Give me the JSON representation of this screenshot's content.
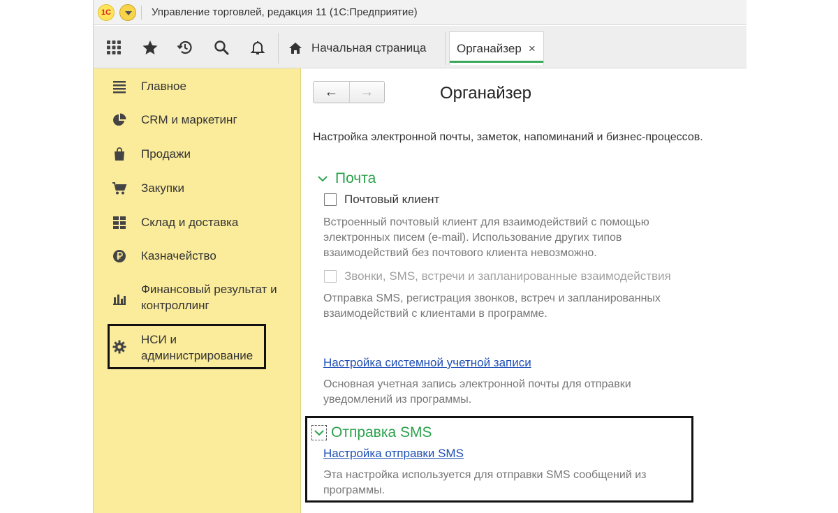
{
  "window": {
    "logo": "1С",
    "title": "Управление торговлей, редакция 11  (1С:Предприятие)"
  },
  "toolbar": {
    "icons": [
      "apps-grid-icon",
      "star-icon",
      "history-icon",
      "search-icon",
      "bell-icon"
    ],
    "tabs": [
      {
        "label": "Начальная страница",
        "icon": "home-icon",
        "active": false
      },
      {
        "label": "Органайзер",
        "active": true,
        "close": "×"
      }
    ]
  },
  "sidebar": {
    "items": [
      {
        "label": "Главное",
        "icon": "menu-lines-icon"
      },
      {
        "label": "CRM и маркетинг",
        "icon": "pie-chart-icon"
      },
      {
        "label": "Продажи",
        "icon": "shopping-bag-icon"
      },
      {
        "label": "Закупки",
        "icon": "cart-icon"
      },
      {
        "label": "Склад и доставка",
        "icon": "warehouse-grid-icon"
      },
      {
        "label": "Казначейство",
        "icon": "ruble-coin-icon"
      },
      {
        "label": "Финансовый результат и",
        "label2": "контроллинг",
        "icon": "bar-chart-icon"
      },
      {
        "label": "НСИ и",
        "label2": "администрирование",
        "icon": "gear-icon",
        "highlighted": true
      }
    ]
  },
  "content": {
    "nav": {
      "back": "←",
      "forward": "→"
    },
    "title": "Органайзер",
    "description": "Настройка электронной почты, заметок, напоминаний и бизнес-процессов.",
    "mail": {
      "heading": "Почта",
      "client_checkbox": {
        "label": "Почтовый клиент",
        "checked": false
      },
      "client_note": [
        "Встроенный почтовый клиент для взаимодействий с помощью",
        "электронных писем (e-mail). Использование других типов",
        "взаимодействий без почтового клиента невозможно."
      ],
      "calls_checkbox": {
        "label": "Звонки, SMS, встречи и запланированные взаимодействия",
        "checked": false,
        "disabled": true
      },
      "calls_note": [
        "Отправка SMS, регистрация звонков, встреч и запланированных",
        "взаимодействий с клиентами в программе."
      ],
      "account_link": "Настройка системной учетной записи",
      "account_note": [
        "Основная учетная запись электронной почты для отправки",
        "уведомлений из программы."
      ]
    },
    "sms": {
      "heading": "Отправка SMS",
      "link": "Настройка отправки SMS",
      "note": [
        "Эта настройка используется для отправки SMS сообщений из",
        "программы."
      ]
    }
  },
  "colors": {
    "sidebar_bg": "#fbec9c",
    "group_heading": "#2ba24c",
    "link": "#1f4fb5",
    "active_tab_underline": "#39a85a"
  }
}
